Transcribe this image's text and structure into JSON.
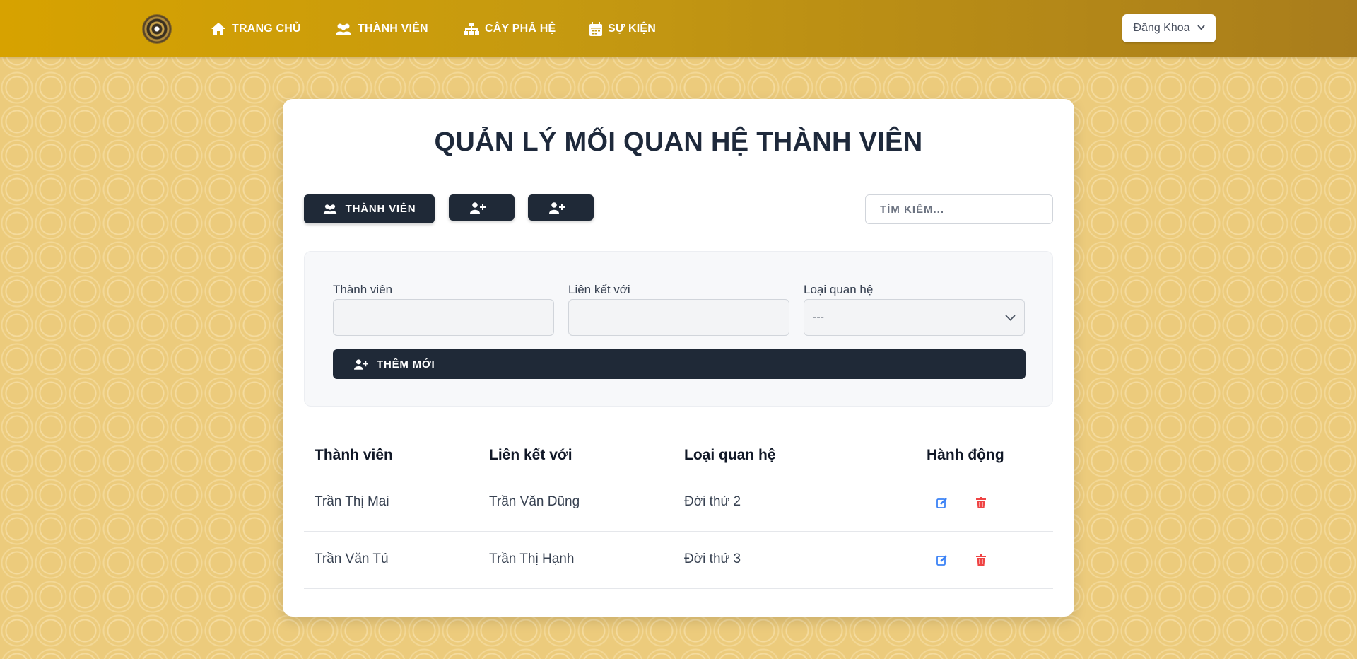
{
  "nav": {
    "items": [
      {
        "label": "TRANG CHỦ",
        "icon": "home-icon"
      },
      {
        "label": "THÀNH VIÊN",
        "icon": "users-icon"
      },
      {
        "label": "CÂY PHẢ HỆ",
        "icon": "sitemap-icon"
      },
      {
        "label": "SỰ KIỆN",
        "icon": "calendar-icon"
      }
    ],
    "user_label": "Đăng Khoa"
  },
  "page": {
    "title": "QUẢN LÝ MỐI QUAN HỆ THÀNH VIÊN"
  },
  "toolbar": {
    "members_label": "THÀNH VIÊN",
    "search_placeholder": "TÌM KIẾM..."
  },
  "form": {
    "member_label": "Thành viên",
    "member_value": "",
    "linked_label": "Liên kết với",
    "linked_value": "",
    "type_label": "Loại quan hệ",
    "type_value": "---",
    "add_label": "THÊM MỚI"
  },
  "table": {
    "headers": [
      "Thành viên",
      "Liên kết với",
      "Loại quan hệ",
      "Hành động"
    ],
    "rows": [
      [
        "Trần Thị Mai",
        "Trần Văn Dũng",
        "Đời thứ 2"
      ],
      [
        "Trần Văn Tú",
        "Trần Thị Hạnh",
        "Đời thứ 3"
      ]
    ]
  },
  "colors": {
    "primary_dark": "#1f2937",
    "navbar": "#c69a10",
    "edit": "#3b82f6",
    "delete": "#ef4444"
  }
}
